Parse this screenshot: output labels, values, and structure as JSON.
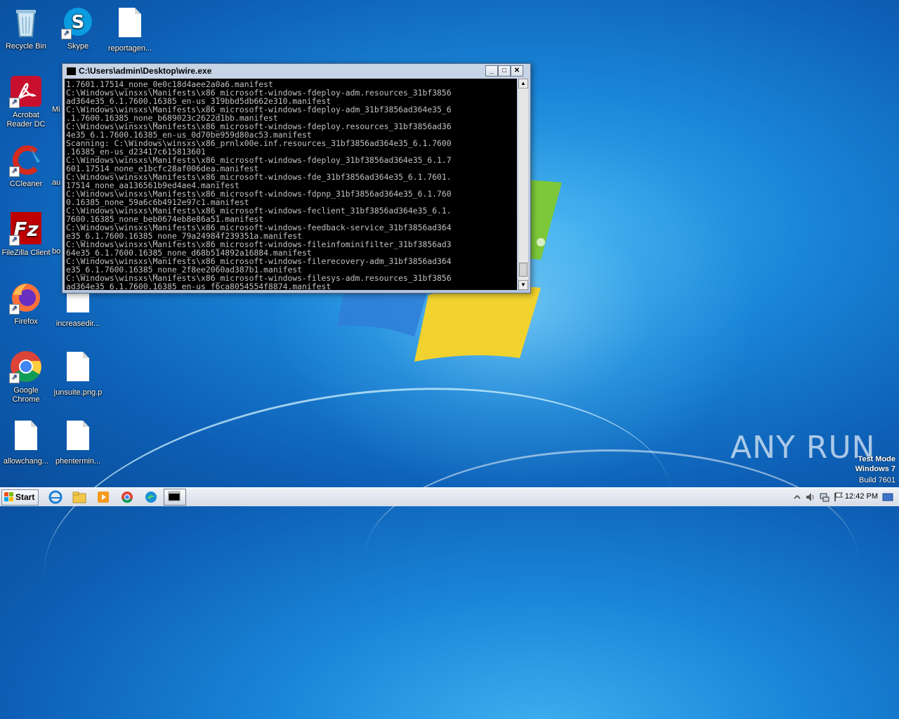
{
  "desktop": {
    "icons": [
      {
        "label": "Recycle Bin"
      },
      {
        "label": "Skype"
      },
      {
        "label": "reportagen..."
      },
      {
        "label": "Acrobat Reader DC"
      },
      {
        "label": "Mi"
      },
      {
        "label": "CCleaner"
      },
      {
        "label": "au"
      },
      {
        "label": "FileZilla Client"
      },
      {
        "label": "bo"
      },
      {
        "label": "Firefox"
      },
      {
        "label": "increasedir..."
      },
      {
        "label": "Google Chrome"
      },
      {
        "label": "junsuite.png.p"
      },
      {
        "label": "allowchang..."
      },
      {
        "label": "phentermin..."
      }
    ]
  },
  "console_window": {
    "title": "C:\\Users\\admin\\Desktop\\wire.exe",
    "minimize": "_",
    "maximize": "□",
    "close": "✕",
    "output": "1.7601.17514_none_0e0c18d4aee2a0a6.manifest\nC:\\Windows\\winsxs\\Manifests\\x86_microsoft-windows-fdeploy-adm.resources_31bf3856\nad364e35_6.1.7600.16385_en-us_319bbd5db662e310.manifest\nC:\\Windows\\winsxs\\Manifests\\x86_microsoft-windows-fdeploy-adm_31bf3856ad364e35_6\n.1.7600.16385_none_b689023c2622d1bb.manifest\nC:\\Windows\\winsxs\\Manifests\\x86_microsoft-windows-fdeploy.resources_31bf3856ad36\n4e35_6.1.7600.16385_en-us_0d70be959d80ac53.manifest\nScanning: C:\\Windows\\winsxs\\x86_prnlx00e.inf.resources_31bf3856ad364e35_6.1.7600\n.16385_en-us_d23417c615813601\nC:\\Windows\\winsxs\\Manifests\\x86_microsoft-windows-fdeploy_31bf3856ad364e35_6.1.7\n601.17514_none_e1bcfc28af006dea.manifest\nC:\\Windows\\winsxs\\Manifests\\x86_microsoft-windows-fde_31bf3856ad364e35_6.1.7601.\n17514_none_aa136561b9ed4ae4.manifest\nC:\\Windows\\winsxs\\Manifests\\x86_microsoft-windows-fdpnp_31bf3856ad364e35_6.1.760\n0.16385_none_59a6c6b4912e97c1.manifest\nC:\\Windows\\winsxs\\Manifests\\x86_microsoft-windows-feclient_31bf3856ad364e35_6.1.\n7600.16385_none_beb0674eb8e86a51.manifest\nC:\\Windows\\winsxs\\Manifests\\x86_microsoft-windows-feedback-service_31bf3856ad364\ne35_6.1.7600.16385_none_79a24984f239351a.manifest\nC:\\Windows\\winsxs\\Manifests\\x86_microsoft-windows-fileinfominifilter_31bf3856ad3\n64e35_6.1.7600.16385_none_d68b514892a16884.manifest\nC:\\Windows\\winsxs\\Manifests\\x86_microsoft-windows-filerecovery-adm_31bf3856ad364\ne35_6.1.7600.16385_none_2f8ee2060ad387b1.manifest\nC:\\Windows\\winsxs\\Manifests\\x86_microsoft-windows-filesys-adm.resources_31bf3856\nad364e35_6.1.7600.16385_en-us_f6ca8054554f8874.manifest"
  },
  "taskbar": {
    "start_label": "Start",
    "clock": "12:42 PM"
  },
  "watermark": {
    "line1": "Test Mode",
    "line2": "Windows 7",
    "line3": "Build 7601",
    "brand": "ANY RUN"
  }
}
